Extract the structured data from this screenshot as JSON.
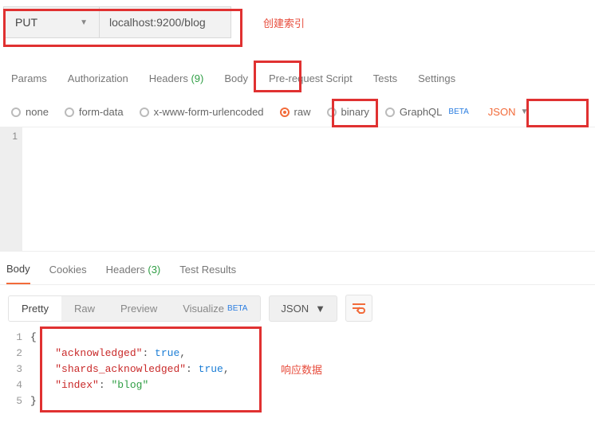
{
  "request": {
    "method": "PUT",
    "url": "localhost:9200/blog",
    "annotation": "创建索引"
  },
  "req_tabs": {
    "params": "Params",
    "authorization": "Authorization",
    "headers_label": "Headers",
    "headers_count": "(9)",
    "body": "Body",
    "prerequest": "Pre-request Script",
    "tests": "Tests",
    "settings": "Settings"
  },
  "body_types": {
    "none": "none",
    "formdata": "form-data",
    "xwww": "x-www-form-urlencoded",
    "raw": "raw",
    "binary": "binary",
    "graphql": "GraphQL",
    "beta": "BETA",
    "json": "JSON"
  },
  "editor": {
    "line1": "1"
  },
  "res_tabs": {
    "body": "Body",
    "cookies": "Cookies",
    "headers_label": "Headers",
    "headers_count": "(3)",
    "testresults": "Test Results"
  },
  "res_toolbar": {
    "pretty": "Pretty",
    "raw": "Raw",
    "preview": "Preview",
    "visualize": "Visualize",
    "beta": "BETA",
    "format": "JSON"
  },
  "response": {
    "lines": [
      "1",
      "2",
      "3",
      "4",
      "5"
    ],
    "brace_open": "{",
    "k1": "\"acknowledged\"",
    "v1": "true",
    "k2": "\"shards_acknowledged\"",
    "v2": "true",
    "k3": "\"index\"",
    "v3": "\"blog\"",
    "brace_close": "}",
    "annotation": "响应数据"
  }
}
